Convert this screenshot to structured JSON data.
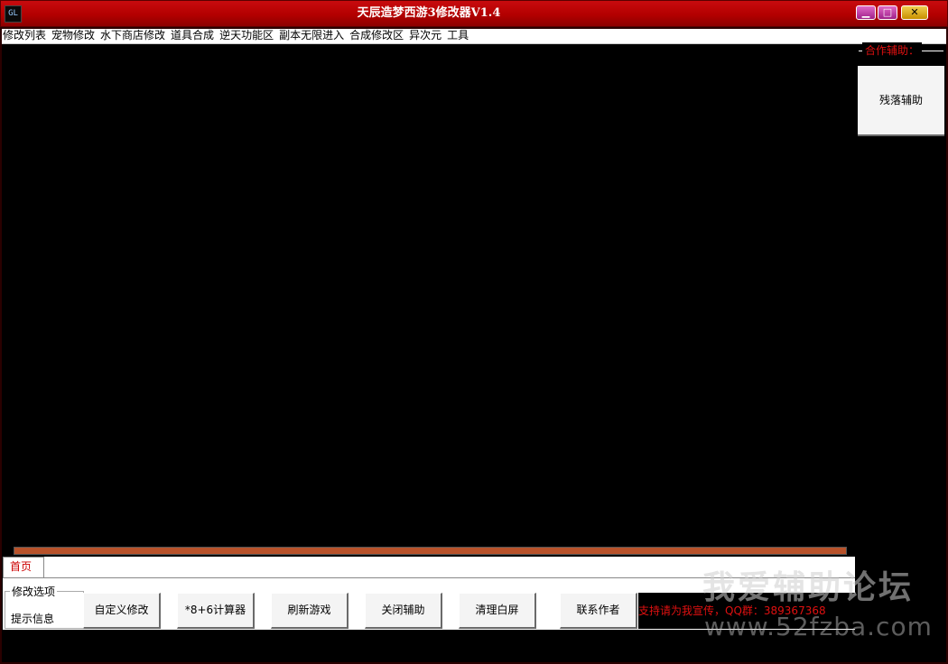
{
  "window": {
    "title": "天辰造梦西游3修改器V1.4",
    "icon": "app-icon",
    "controls": {
      "minimize": "minimize-icon",
      "maximize": "maximize-icon",
      "close": "close-icon"
    }
  },
  "menu": [
    "修改列表",
    "宠物修改",
    "水下商店修改",
    "道具合成",
    "逆天功能区",
    "副本无限进入",
    "合成修改区",
    "异次元",
    "工具"
  ],
  "tabs": [
    {
      "label": "首页",
      "selected": true
    }
  ],
  "group": {
    "legend": "修改选项",
    "hint_label": "提示信息"
  },
  "buttons": [
    "自定义修改",
    "*8+6计算器",
    "刷新游戏",
    "关闭辅助",
    "清理白屏",
    "联系作者"
  ],
  "support_text": "支持请为我宣传，QQ群：389367368",
  "side": {
    "legend": "合作辅助：",
    "button": "残落辅助"
  },
  "watermark": {
    "title": "我爱辅助论坛",
    "url": "www.52fzba.com"
  },
  "colors": {
    "titlebar": "#b30000",
    "accent_text": "#e01010",
    "content_bg": "#000000",
    "progress": "#b8522a"
  }
}
